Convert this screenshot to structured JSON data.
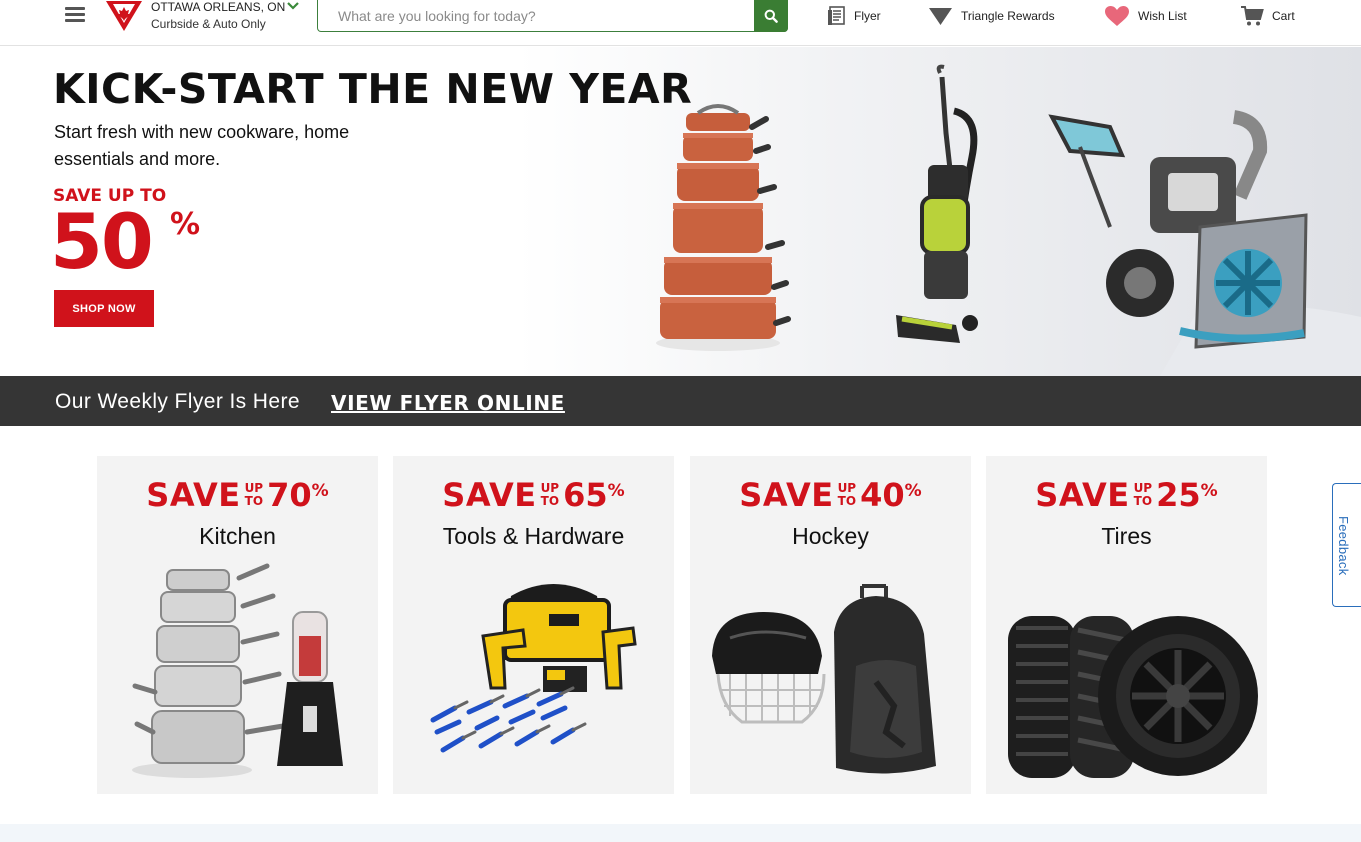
{
  "header": {
    "store_name": "OTTAWA ORLEANS, ON",
    "store_sub": "Curbside & Auto Only",
    "search_placeholder": "What are you looking for today?",
    "nav": {
      "flyer": "Flyer",
      "rewards": "Triangle Rewards",
      "wishlist": "Wish List",
      "cart": "Cart"
    }
  },
  "hero": {
    "title": "KICK-START THE NEW YEAR",
    "subtitle": "Start fresh with new cookware, home essentials and more.",
    "save_label": "SAVE UP TO",
    "save_value": "50",
    "save_symbol": "%",
    "cta": "SHOP NOW"
  },
  "flyer_strip": {
    "text": "Our Weekly Flyer Is Here",
    "link": "VIEW FLYER ONLINE"
  },
  "tiles": [
    {
      "save": "SAVE",
      "up": "UP",
      "to": "TO",
      "value": "70",
      "pct": "%",
      "name": "Kitchen"
    },
    {
      "save": "SAVE",
      "up": "UP",
      "to": "TO",
      "value": "65",
      "pct": "%",
      "name": "Tools & Hardware"
    },
    {
      "save": "SAVE",
      "up": "UP",
      "to": "TO",
      "value": "40",
      "pct": "%",
      "name": "Hockey"
    },
    {
      "save": "SAVE",
      "up": "UP",
      "to": "TO",
      "value": "25",
      "pct": "%",
      "name": "Tires"
    }
  ],
  "feedback": "Feedback",
  "colors": {
    "brand_red": "#d0121b",
    "search_green": "#3a7d33",
    "strip_dark": "#353535",
    "feedback_blue": "#2a6ebb"
  },
  "icons": [
    "menu-icon",
    "logo-icon",
    "chevron-down-icon",
    "search-icon",
    "flyer-icon",
    "triangle-icon",
    "heart-icon",
    "cart-icon"
  ]
}
